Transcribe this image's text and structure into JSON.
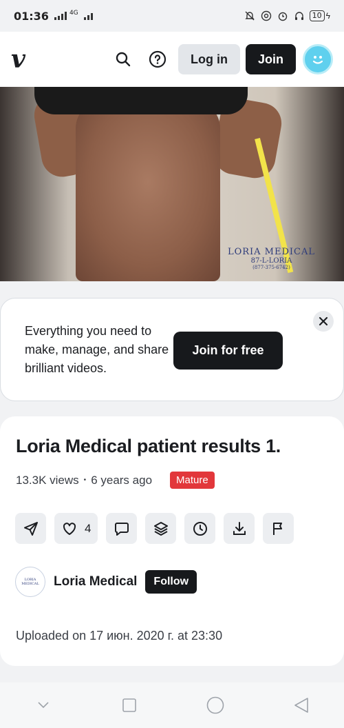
{
  "status_bar": {
    "time": "01:36",
    "network": "4G",
    "battery": "10"
  },
  "nav": {
    "logo": "v",
    "login_label": "Log in",
    "join_label": "Join"
  },
  "video": {
    "watermark_line1": "LORIA MEDICAL",
    "watermark_line2": "87-L-LORIA",
    "watermark_line3": "(877-375-6742)"
  },
  "promo": {
    "text": "Everything you need to make, manage, and share brilliant videos.",
    "cta_label": "Join for free"
  },
  "info": {
    "title": "Loria Medical patient results 1.",
    "views": "13.3K views",
    "separator": "•",
    "age": "6 years ago",
    "badge": "Mature",
    "like_count": "4",
    "channel_avatar_text": "LORIA MEDICAL",
    "channel_name": "Loria Medical",
    "follow_label": "Follow",
    "uploaded": "Uploaded on 17 июн. 2020 г. at 23:30"
  },
  "colors": {
    "accent_dark": "#17191c",
    "mature_red": "#e2373b",
    "avatar_cyan": "#5fd0ee"
  }
}
